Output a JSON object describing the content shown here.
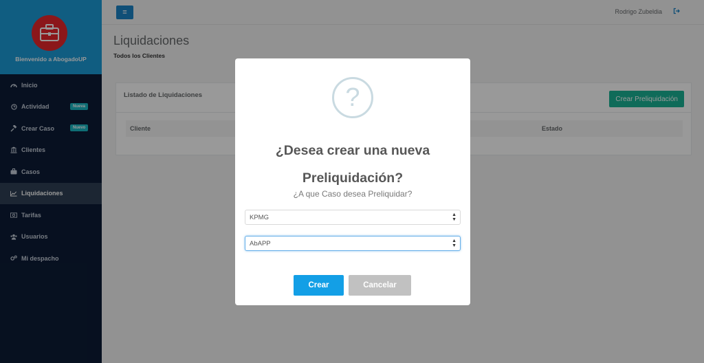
{
  "sidebar": {
    "welcome": "Bienvenido a AbogadoUP",
    "items": [
      {
        "label": "Inicio",
        "icon": "dashboard-icon"
      },
      {
        "label": "Actividad",
        "icon": "clock-icon",
        "badge": "Nueva"
      },
      {
        "label": "Crear Caso",
        "icon": "gavel-icon",
        "badge": "Nuevo"
      },
      {
        "label": "Clientes",
        "icon": "bank-icon"
      },
      {
        "label": "Casos",
        "icon": "briefcase-icon"
      },
      {
        "label": "Liquidaciones",
        "icon": "line-chart-icon",
        "active": true
      },
      {
        "label": "Tarifas",
        "icon": "money-icon"
      },
      {
        "label": "Usuarios",
        "icon": "users-icon"
      },
      {
        "label": "Mi despacho",
        "icon": "cogs-icon"
      }
    ]
  },
  "topbar": {
    "user": "Rodrigo Zubeldia"
  },
  "page": {
    "title": "Liquidaciones",
    "breadcrumb": "Todos los Clientes"
  },
  "panel": {
    "title": "Listado de Liquidaciones",
    "button": "Crear Preliquidación",
    "columns": [
      "Cliente",
      "Estado"
    ]
  },
  "modal": {
    "title": "¿Desea crear una nueva Preliquidación?",
    "text": "¿A que Caso desea Preliquidar?",
    "select1": "KPMG",
    "select2": "AbAPP",
    "confirm": "Crear",
    "cancel": "Cancelar"
  },
  "colors": {
    "sidebar_bg": "#0c1c36",
    "header_bg": "#1b9bd8",
    "logo_red": "#e8272c",
    "primary": "#139fe6",
    "teal": "#1ab394"
  }
}
